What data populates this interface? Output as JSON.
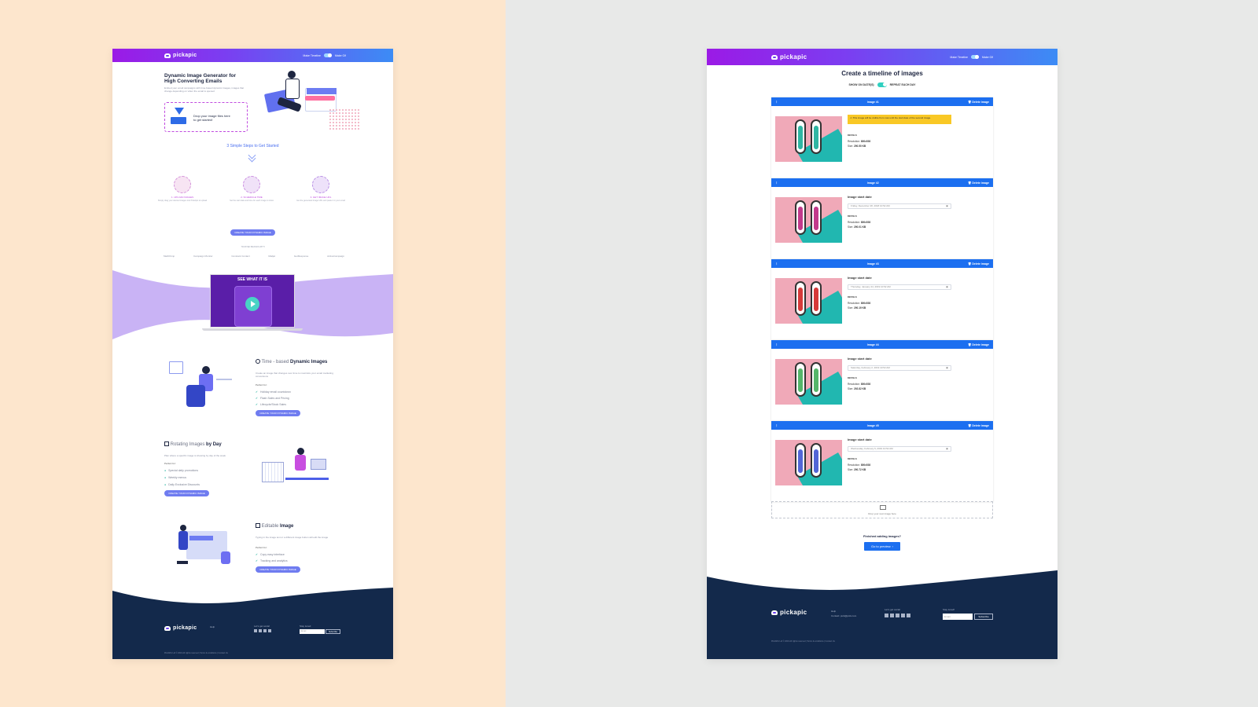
{
  "brand": "pickapic",
  "nav": {
    "make_timeline": "Make Timeline",
    "make_gif": "Make Gif"
  },
  "colors": {
    "left_bg": "#fde6cd",
    "right_bg": "#e8e9e8",
    "nav_start": "#9b1ae6",
    "nav_end": "#3c8cf5",
    "card_header": "#1c6ff0",
    "footer": "#13294b",
    "warning": "#f9c825"
  },
  "landing": {
    "hero_title_1": "Dynamic Image Generator for",
    "hero_title_2": "High Converting Emails",
    "hero_desc": "Embed your email campaigns with time-based dynamic images, images that change depending on when the email is opened",
    "drop_1": "Drop your image files here",
    "drop_2": "to get started!",
    "steps_title": "3 Simple Steps to Get Started",
    "steps": [
      {
        "label": "1. UPLOAD IMAGES",
        "desc": "Simply drag your desired images into PickApic to upload"
      },
      {
        "label": "2. SCHEDULE TIME",
        "desc": "Set the start date and time for each image to show"
      },
      {
        "label": "3. GET IMAGE URL",
        "desc": "Get the generated image URL and paste it in your email"
      }
    ],
    "cta": "CREATE YOUR DYNAMIC IMAGE",
    "trusted": "TRUSTED BRANDS WITH",
    "brands": [
      "MailChimp",
      "Campaign Monitor",
      "Constant Contact",
      "Mailjet",
      "GetResponse",
      "ActiveCampaign"
    ],
    "video_label": "SEE WHAT IT IS",
    "feature1_title_a": "Time - based ",
    "feature1_title_b": "Dynamic Images",
    "feature1_desc": "Create an image that changes over time to maximize your email marketing conversions",
    "perfect_for": "Perfect for:",
    "feature1_items": [
      "Holiday email countdown",
      "Flash Sales and Pricing",
      "Lifecycle/Stock Sales"
    ],
    "feature2_title_a": "Rotating Images ",
    "feature2_title_b": "by Day",
    "feature2_desc": "Plan where a specific image is showing by day of the week",
    "feature2_items": [
      "Special daily promotions",
      "Weekly menus",
      "Daily Exclusive Discounts"
    ],
    "feature3_title_a": "Editable ",
    "feature3_title_b": "Image",
    "feature3_desc": "Typing in the image text or a different image button will edit the image",
    "feature3_items": [
      "Copy easy interface",
      "Tracking and analytics"
    ],
    "footer_help": "Help",
    "footer_team": "Let's get social",
    "footer_stay": "Stay tuned",
    "footer_email_placeholder": "Email",
    "footer_subscribe": "Subscribe",
    "footer_copy": "PickAPic Ltd © 2019 All rights reserved | Terms & conditions | Contact Us"
  },
  "timeline": {
    "title": "Create a timeline of images",
    "show_on_dates": "SHOW ON DATE(S)",
    "repeat_each_day": "REPEAT EACH DAY",
    "delete": "Delete image",
    "warning": "This image will be visible from now until the start date of the second image.",
    "start_date_label": "Image start date",
    "details": "DETAILS",
    "resolution_label": "Resolution:",
    "size_label": "Size:",
    "images": [
      {
        "name": "Image #1",
        "resolution": "800x530",
        "size": "290.50 KB",
        "date": ""
      },
      {
        "name": "Image #2",
        "resolution": "800x530",
        "size": "290.01 KB",
        "date": "Friday, December 28, 2018 10:52 AM"
      },
      {
        "name": "Image #3",
        "resolution": "800x530",
        "size": "290.19 KB",
        "date": "Thursday, January 24, 2019 10:52 AM"
      },
      {
        "name": "Image #4",
        "resolution": "800x530",
        "size": "292.82 KB",
        "date": "Saturday, February 2, 2019 10:52 AM"
      },
      {
        "name": "Image #5",
        "resolution": "800x530",
        "size": "290.72 KB",
        "date": "Wednesday, February 6, 2019 10:52 AM"
      }
    ],
    "drop_next": "Drop your next image here",
    "finished": "Finished adding images?",
    "go_preview": "Go to preview",
    "footer_help": "Help",
    "footer_contact": "Contact: pick@pick.com",
    "footer_social": "Let's get social",
    "footer_stay": "Stay tuned!",
    "footer_email_placeholder": "Email",
    "footer_subscribe": "Subscribe",
    "footer_copy": "PickAPic Ltd © 2019 All rights reserved | Terms & conditions | Contact Us"
  }
}
